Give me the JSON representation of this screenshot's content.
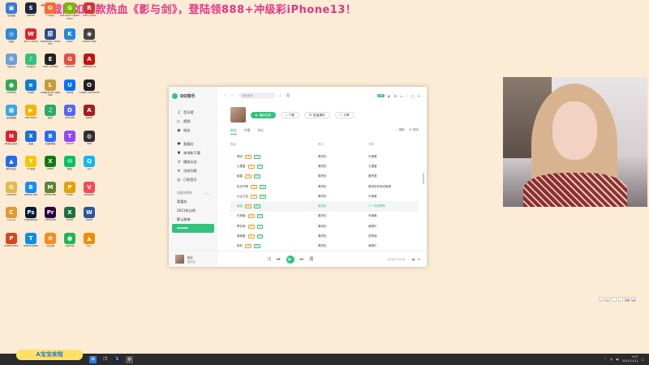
{
  "banner": "下载同如同款热血《影与剑》，登陆领888+冲级彩iPhone13！",
  "desktop_icons": [
    {
      "label": "此电脑",
      "color": "#3a7bd5",
      "glyph": "▣"
    },
    {
      "label": "Steam",
      "color": "#1b2838",
      "glyph": "S"
    },
    {
      "label": "Origin",
      "color": "#f56c2d",
      "glyph": "O"
    },
    {
      "label": "GeForce Experience",
      "color": "#76b900",
      "glyph": "G"
    },
    {
      "label": "Riot Client",
      "color": "#d13639",
      "glyph": "R"
    },
    {
      "label": "网络",
      "color": "#2f86d6",
      "glyph": "◎"
    },
    {
      "label": "WPS Office",
      "color": "#d8262f",
      "glyph": "W"
    },
    {
      "label": "Yuanshen Launcher",
      "color": "#2a4b8d",
      "glyph": "原"
    },
    {
      "label": "Kook",
      "color": "#1e88e5",
      "glyph": "K"
    },
    {
      "label": "Steam Key",
      "color": "#444",
      "glyph": "◉"
    },
    {
      "label": "回收站",
      "color": "#6ea0d8",
      "glyph": "♻"
    },
    {
      "label": "QQ音乐",
      "color": "#31c27c",
      "glyph": "♪"
    },
    {
      "label": "Epic Games",
      "color": "#222",
      "glyph": "E"
    },
    {
      "label": "Garena",
      "color": "#e84c3d",
      "glyph": "G"
    },
    {
      "label": "Among Us",
      "color": "#c51111",
      "glyph": "A"
    },
    {
      "label": "Chrome",
      "color": "#34a853",
      "glyph": "●"
    },
    {
      "label": "Edge",
      "color": "#0f7fd0",
      "glyph": "e"
    },
    {
      "label": "League of Legends",
      "color": "#c79b3b",
      "glyph": "L"
    },
    {
      "label": "Uplay",
      "color": "#0070ff",
      "glyph": "U"
    },
    {
      "label": "Origin Launcher",
      "color": "#222",
      "glyph": "O"
    },
    {
      "label": "控制面板",
      "color": "#3da5e0",
      "glyph": "▦"
    },
    {
      "label": "PotPlayer",
      "color": "#f5b400",
      "glyph": "▶"
    },
    {
      "label": "音乐",
      "color": "#2ca96a",
      "glyph": "♫"
    },
    {
      "label": "Discord",
      "color": "#5865f2",
      "glyph": "D"
    },
    {
      "label": "Apex",
      "color": "#a51d1d",
      "glyph": "A"
    },
    {
      "label": "网易云音乐",
      "color": "#d9232d",
      "glyph": "N"
    },
    {
      "label": "迅雷",
      "color": "#1c6fd9",
      "glyph": "X"
    },
    {
      "label": "百度网盘",
      "color": "#2a6df4",
      "glyph": "B"
    },
    {
      "label": "Twitch",
      "color": "#9146ff",
      "glyph": "T"
    },
    {
      "label": "OBS",
      "color": "#302e31",
      "glyph": "◍"
    },
    {
      "label": "腾讯会议",
      "color": "#1f6cf0",
      "glyph": "▲"
    },
    {
      "label": "YY语音",
      "color": "#f7c600",
      "glyph": "Y"
    },
    {
      "label": "Xbox",
      "color": "#107c10",
      "glyph": "X"
    },
    {
      "label": "微信",
      "color": "#07c160",
      "glyph": "✉"
    },
    {
      "label": "QQ",
      "color": "#12b7f5",
      "glyph": "Q"
    },
    {
      "label": "Genshin",
      "color": "#e3b94b",
      "glyph": "G"
    },
    {
      "label": "Battle.net",
      "color": "#148eff",
      "glyph": "B"
    },
    {
      "label": "Minecraft",
      "color": "#5b8731",
      "glyph": "M"
    },
    {
      "label": "PUBG",
      "color": "#e5a000",
      "glyph": "P"
    },
    {
      "label": "Valorant",
      "color": "#ff4655",
      "glyph": "V"
    },
    {
      "label": "CS:GO",
      "color": "#de9b35",
      "glyph": "C"
    },
    {
      "label": "Photoshop",
      "color": "#001e36",
      "glyph": "Ps"
    },
    {
      "label": "Premiere",
      "color": "#2a0042",
      "glyph": "Pr"
    },
    {
      "label": "Excel",
      "color": "#1d6f42",
      "glyph": "X"
    },
    {
      "label": "Word",
      "color": "#2b579a",
      "glyph": "W"
    },
    {
      "label": "PowerPoint",
      "color": "#d24726",
      "glyph": "P"
    },
    {
      "label": "TeamViewer",
      "color": "#0e8ee9",
      "glyph": "T"
    },
    {
      "label": "向日葵",
      "color": "#f68c1f",
      "glyph": "✿"
    },
    {
      "label": "Spotify",
      "color": "#1db954",
      "glyph": "●"
    },
    {
      "label": "VLC",
      "color": "#f48b00",
      "glyph": "▲"
    }
  ],
  "player": {
    "app_name": "QQ音乐",
    "nav": [
      {
        "label": "音乐馆",
        "icon": "♫"
      },
      {
        "label": "视频",
        "icon": "▷"
      },
      {
        "label": "电台",
        "icon": "◉"
      }
    ],
    "my_music": [
      {
        "label": "我喜欢",
        "icon": "♥"
      },
      {
        "label": "本地和下载",
        "icon": "▼"
      },
      {
        "label": "播放历史",
        "icon": "↺"
      },
      {
        "label": "试听列表",
        "icon": "≡"
      },
      {
        "label": "已购音乐",
        "icon": "◎"
      }
    ],
    "playlist_header": "创建的歌单",
    "playlists": [
      "我喜欢",
      "2021听过的",
      "默认歌单",
      "❤❤❤❤"
    ],
    "search_placeholder": "搜索音乐",
    "user": "月",
    "vip": "VIP",
    "buttons": {
      "play_all": "播放全部",
      "download": "下载",
      "batch": "批量操作",
      "share": "分享"
    },
    "tabs": [
      "歌曲",
      "专辑",
      "评论"
    ],
    "tab_tools": [
      "搜索",
      "排序"
    ],
    "columns": {
      "title": "歌曲",
      "singer": "歌手",
      "album": "专辑"
    },
    "songs": [
      {
        "title": "晴天",
        "singer": "周杰伦",
        "album": "叶惠美"
      },
      {
        "title": "七里香",
        "singer": "周杰伦",
        "album": "七里香"
      },
      {
        "title": "稻香",
        "singer": "周杰伦",
        "album": "魔杰座"
      },
      {
        "title": "告白气球",
        "singer": "周杰伦",
        "album": "周杰伦的床边故事"
      },
      {
        "title": "以父之名",
        "singer": "周杰伦",
        "album": "叶惠美"
      },
      {
        "title": "夜曲",
        "singer": "周杰伦",
        "album": "十一月的萧邦"
      },
      {
        "title": "东风破",
        "singer": "周杰伦",
        "album": "叶惠美"
      },
      {
        "title": "青花瓷",
        "singer": "周杰伦",
        "album": "我很忙"
      },
      {
        "title": "简单爱",
        "singer": "周杰伦",
        "album": "范特西"
      },
      {
        "title": "彩虹",
        "singer": "周杰伦",
        "album": "我很忙"
      }
    ],
    "now_playing": {
      "title": "晴天",
      "artist": "周杰伦",
      "time": "01:06 / 04:29"
    }
  },
  "stream_tag": "A宝宝来啦",
  "clock": {
    "time": "0:07",
    "date": "2021/11/11"
  }
}
